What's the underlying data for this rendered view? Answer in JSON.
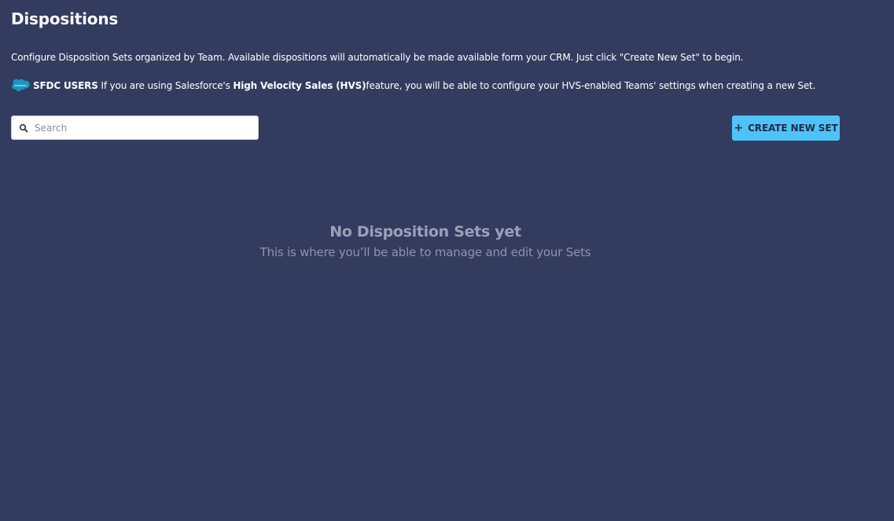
{
  "header": {
    "title": "Dispositions"
  },
  "description": "Configure Disposition Sets organized by Team. Available dispositions will automatically be made available form your CRM. Just click \"Create New Set\" to begin.",
  "sfdc_note": {
    "logo_icon": "salesforce-logo-icon",
    "label": "SFDC USERS",
    "text_before": " If you are using Salesforce's ",
    "feature": "High Velocity Sales (HVS)",
    "text_after": " feature, you will be able to configure your HVS-enabled Teams' settings when creating a new Set."
  },
  "search": {
    "icon": "search-icon",
    "placeholder": "Search",
    "value": ""
  },
  "toolbar": {
    "create_icon": "+",
    "create_label": "CREATE NEW SET"
  },
  "empty_state": {
    "title": "No Disposition Sets yet",
    "subtitle": "This is where you’ll be able to manage and edit your Sets"
  },
  "colors": {
    "background": "#333c5f",
    "accent": "#4fc3f7",
    "salesforce_blue": "#1798c1"
  }
}
